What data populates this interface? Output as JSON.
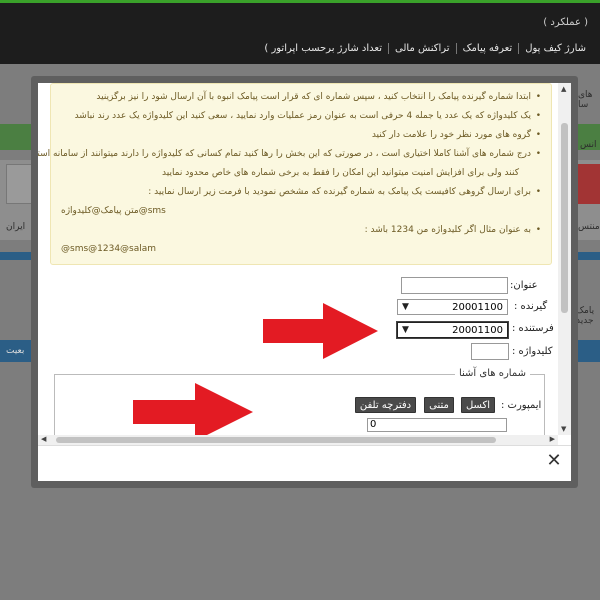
{
  "header": {
    "user_text": "( عملکرد )",
    "nav": [
      "شارژ کیف پول",
      "تعرفه پیامک",
      "تراکنش مالی",
      "تعداد شارژ برحسب اپراتور )"
    ]
  },
  "background": {
    "frag_top_right": "های سا",
    "frag_right_1": "انس",
    "frag_right_2": "منتس",
    "frag_left_1": "ایران",
    "frag_right_3": "یامک جدید",
    "frag_left_2": "بعیت"
  },
  "notice": {
    "items": [
      "ابتدا شماره گیرنده پیامک را انتخاب کنید ، سپس شماره ای که قرار است پیامک انبوه با آن ارسال شود را نیز برگزینید",
      "یک کلیدواژه که یک عدد یا جمله 4 حرفی است به عنوان رمز عملیات وارد نمایید ، سعی کنید این کلیدواژه یک عدد رند نباشد",
      "گروه های مورد نظر خود را علامت دار کنید",
      "درج شماره های آشنا کاملا اختیاری است ، در صورتی که این بخش را رها کنید تمام کسانی که کلیدواژه را دارند میتوانند از سامانه استفاده",
      "کنند ولی برای افزایش امنیت میتوانید این امکان را فقط به برخی شماره های خاص محدود نمایید",
      "برای ارسال گروهی کافیست یک پیامک به شماره گیرنده که مشخص نمودید با فرمت زیر ارسال نمایید :",
      "متن پیامک@کلیدواژه@sms",
      "به عنوان مثال اگر کلیدواژه من 1234 باشد :",
      "@sms@1234@salam"
    ]
  },
  "form": {
    "title_label": "عنوان:",
    "title_value": "",
    "receiver_label": "گیرنده :",
    "receiver_value": "20001100",
    "sender_label": "فرستنده :",
    "sender_value": "20001100",
    "keyword_label": "کلیدواژه :",
    "keyword_value": ""
  },
  "known_numbers": {
    "legend": "شماره های آشنا",
    "import_label": "ایمپورت :",
    "buttons": [
      "اکسل",
      "متنی",
      "دفترچه تلفن"
    ],
    "input_value": "0"
  },
  "dialog": {
    "close_glyph": "✕"
  },
  "colors": {
    "notice_bg": "#fbf8e0",
    "arrow_red": "#e31b23",
    "header_green": "#3aa12a"
  },
  "icons": [
    "close-icon",
    "chevron-down-icon",
    "red-arrow-icon"
  ]
}
